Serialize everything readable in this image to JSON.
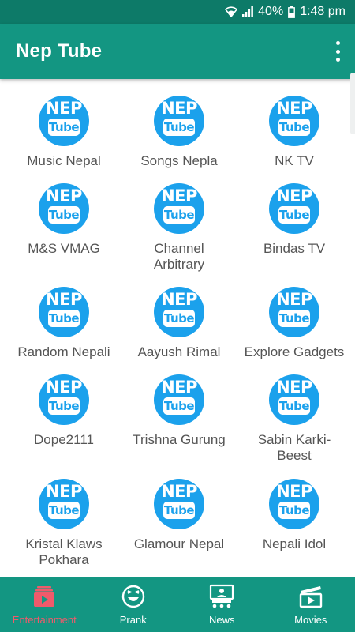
{
  "status_bar": {
    "battery": "40%",
    "time": "1:48 pm"
  },
  "app_bar": {
    "title": "Nep Tube"
  },
  "logo": {
    "line1": "NEP",
    "line2": "Tube"
  },
  "channels": [
    [
      "Music Nepal"
    ],
    [
      "Songs Nepla"
    ],
    [
      "NK TV"
    ],
    [
      "M&S VMAG"
    ],
    [
      "Channel",
      "Arbitrary"
    ],
    [
      "Bindas TV"
    ],
    [
      "Random Nepali"
    ],
    [
      "Aayush Rimal"
    ],
    [
      "Explore Gadgets"
    ],
    [
      "Dope2111"
    ],
    [
      "Trishna Gurung"
    ],
    [
      "Sabin Karki-",
      "Beest"
    ],
    [
      "Kristal Klaws",
      "Pokhara"
    ],
    [
      "Glamour Nepal"
    ],
    [
      "Nepali Idol"
    ]
  ],
  "bottom_nav": [
    {
      "label": "Entertainment",
      "icon": "entertainment-icon",
      "active": true
    },
    {
      "label": "Prank",
      "icon": "laughing-face-icon",
      "active": false
    },
    {
      "label": "News",
      "icon": "news-presenter-icon",
      "active": false
    },
    {
      "label": "Movies",
      "icon": "clapperboard-icon",
      "active": false
    }
  ],
  "colors": {
    "status_bar": "#0d7a68",
    "primary": "#139682",
    "logo_blue": "#1ba1ec",
    "active_tab": "#ef5a6b"
  }
}
